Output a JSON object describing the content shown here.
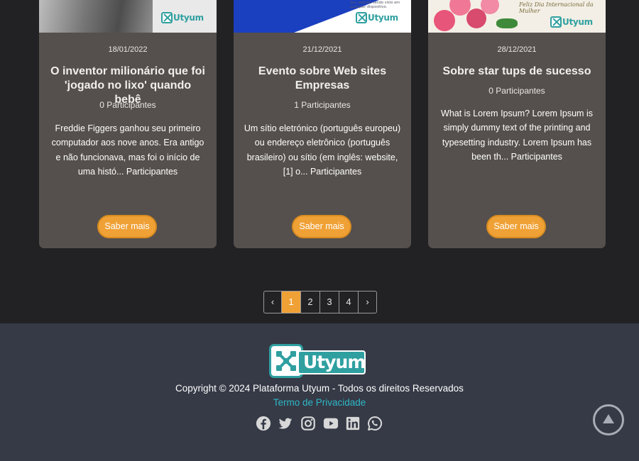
{
  "cards": [
    {
      "date": "18/01/2022",
      "title": "O inventor milionário que foi 'jogado no lixo' quando bebê",
      "participants": "0 Participantes",
      "excerpt": "Freddie Figgers ganhou seu primeiro computador aos nove anos. Era antigo e não funcionava, mas foi o início de uma histó... Participantes",
      "button": "Saber mais",
      "thumb_logo": "Utyum"
    },
    {
      "date": "21/12/2021",
      "title": "Evento sobre Web sites Empresas",
      "participants": "1 Participantes",
      "excerpt": "Um sítio eletrónico (português europeu) ou endereço eletrônico (português brasileiro) ou sítio (em inglês: website,[1] o... Participantes",
      "button": "Saber mais",
      "thumb_text": "Seu website sendo visto em qualquer dispositivo.",
      "thumb_logo": "Utyum"
    },
    {
      "date": "28/12/2021",
      "title": "Sobre star tups de sucesso",
      "participants": "0 Participantes",
      "excerpt": "What is Lorem Ipsum? Lorem Ipsum is simply dummy text of the printing and typesetting industry. Lorem Ipsum has been th... Participantes",
      "button": "Saber mais",
      "thumb_text": "Feliz Dia Internacional da Mulher",
      "thumb_logo": "Utyum"
    }
  ],
  "pagination": {
    "prev": "‹",
    "next": "›",
    "pages": [
      "1",
      "2",
      "3",
      "4"
    ],
    "active": "1"
  },
  "footer": {
    "logo_text": "Utyum",
    "copyright": "Copyright © 2024 Plataforma Utyum - Todos os direitos Reservados",
    "privacy": "Termo de Privacidade",
    "socials": [
      "facebook-icon",
      "twitter-icon",
      "instagram-icon",
      "youtube-icon",
      "linkedin-icon",
      "whatsapp-icon"
    ]
  },
  "colors": {
    "page_bg": "#222124",
    "card_bg": "#55504d",
    "accent": "#f0a136",
    "footer_bg": "#353a46",
    "link": "#2fb7c6",
    "brand_teal": "#2f9fa0"
  }
}
